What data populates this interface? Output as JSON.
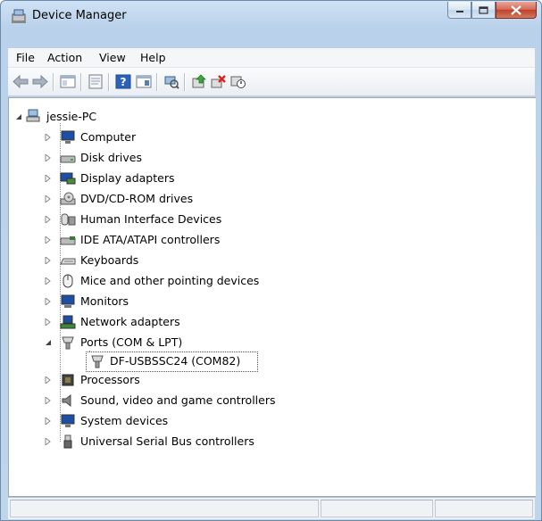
{
  "window": {
    "title": "Device Manager"
  },
  "menu": [
    "File",
    "Action",
    "View",
    "Help"
  ],
  "toolbar": {
    "buttons": [
      "back-icon",
      "forward-icon",
      "show-hide-console-tree-icon",
      "properties-icon",
      "help-icon",
      "view-icon",
      "scan-hardware-icon",
      "update-driver-icon",
      "uninstall-icon",
      "disable-icon"
    ]
  },
  "tree": {
    "root": "jessie-PC",
    "items": [
      {
        "label": "Computer",
        "icon": "computer-icon",
        "expanded": false
      },
      {
        "label": "Disk drives",
        "icon": "disk-drive-icon",
        "expanded": false
      },
      {
        "label": "Display adapters",
        "icon": "display-adapter-icon",
        "expanded": false
      },
      {
        "label": "DVD/CD-ROM drives",
        "icon": "dvd-drive-icon",
        "expanded": false
      },
      {
        "label": "Human Interface Devices",
        "icon": "hid-icon",
        "expanded": false
      },
      {
        "label": "IDE ATA/ATAPI controllers",
        "icon": "ide-controller-icon",
        "expanded": false
      },
      {
        "label": "Keyboards",
        "icon": "keyboard-icon",
        "expanded": false
      },
      {
        "label": "Mice and other pointing devices",
        "icon": "mouse-icon",
        "expanded": false
      },
      {
        "label": "Monitors",
        "icon": "monitor-icon",
        "expanded": false
      },
      {
        "label": "Network adapters",
        "icon": "network-adapter-icon",
        "expanded": false
      },
      {
        "label": "Ports (COM & LPT)",
        "icon": "port-icon",
        "expanded": true
      },
      {
        "label": "Processors",
        "icon": "processor-icon",
        "expanded": false
      },
      {
        "label": "Sound, video and game controllers",
        "icon": "sound-icon",
        "expanded": false
      },
      {
        "label": "System devices",
        "icon": "system-devices-icon",
        "expanded": false
      },
      {
        "label": "Universal Serial Bus controllers",
        "icon": "usb-icon",
        "expanded": false
      }
    ],
    "child": {
      "label": "DF-USBSSC24 (COM82)",
      "icon": "port-icon"
    }
  },
  "colors": {
    "selection_border": "#555555",
    "title_bar": "#b9d1ea",
    "close_button": "#c0402b"
  }
}
